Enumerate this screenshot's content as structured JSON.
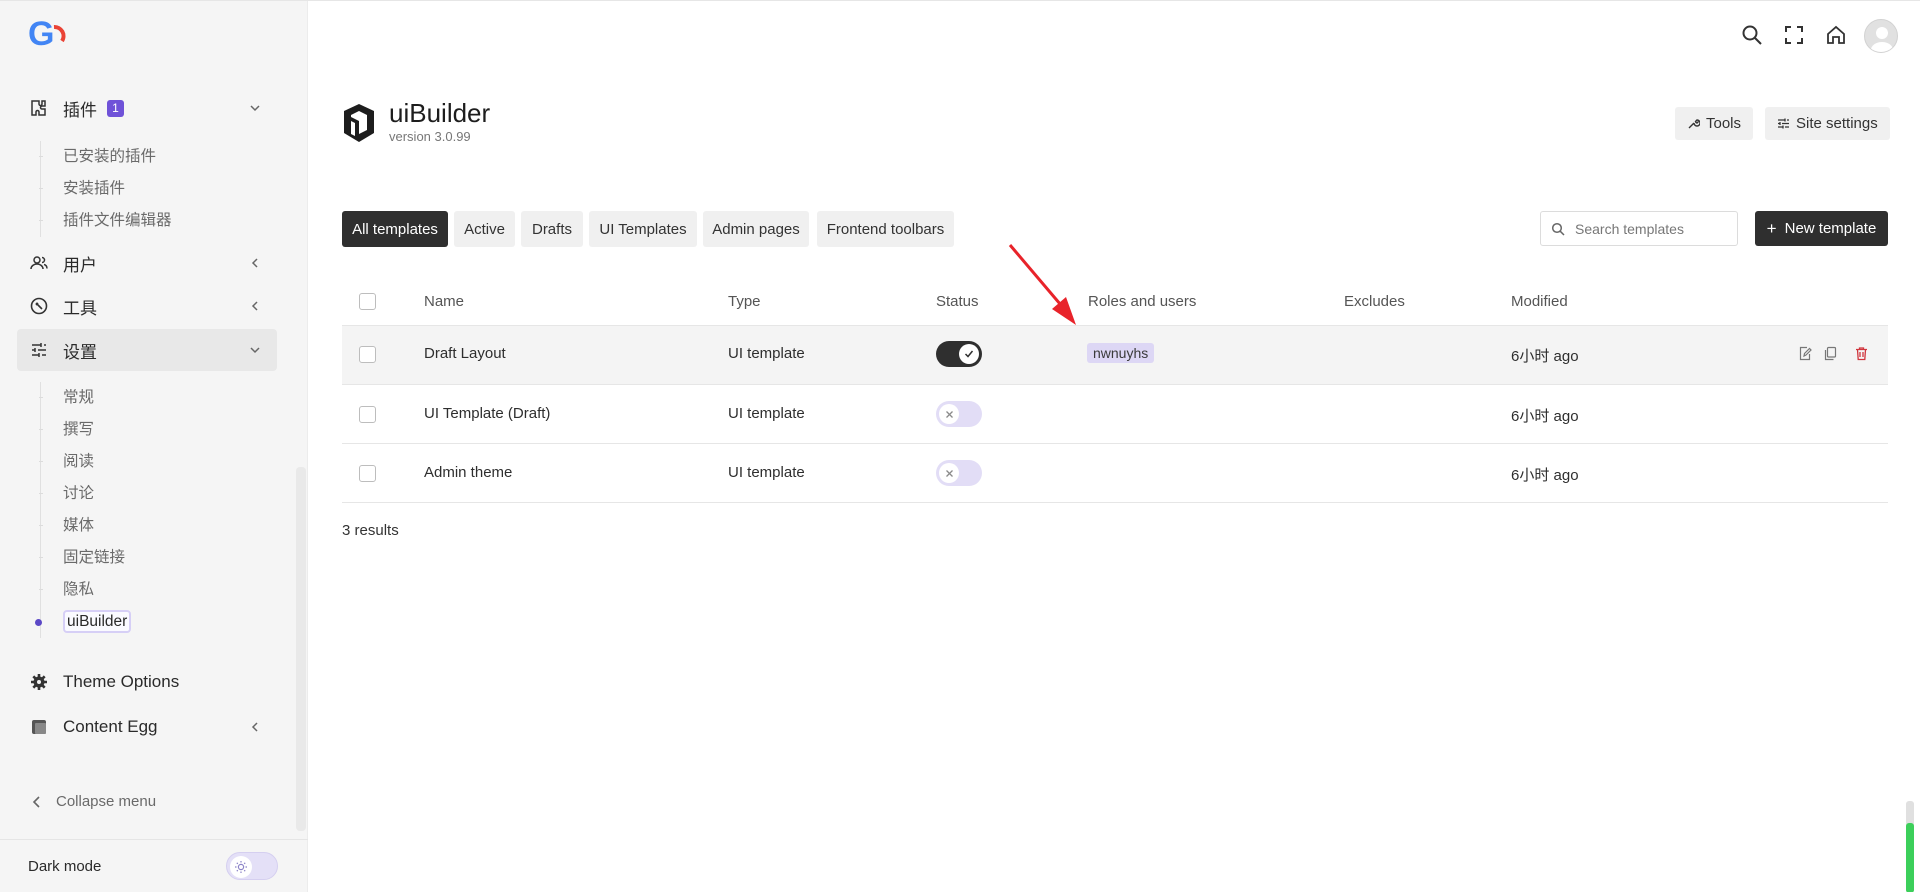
{
  "sidebar": {
    "plugins": {
      "label": "插件",
      "badge": "1",
      "items": [
        "已安装的插件",
        "安装插件",
        "插件文件编辑器"
      ]
    },
    "users": {
      "label": "用户"
    },
    "tools": {
      "label": "工具"
    },
    "settings": {
      "label": "设置",
      "items": [
        "常规",
        "撰写",
        "阅读",
        "讨论",
        "媒体",
        "固定链接",
        "隐私",
        "uiBuilder"
      ]
    },
    "theme_options": {
      "label": "Theme Options"
    },
    "content_egg": {
      "label": "Content Egg"
    },
    "collapse_label": "Collapse menu",
    "dark_mode_label": "Dark mode"
  },
  "header": {
    "title": "uiBuilder",
    "version": "version 3.0.99",
    "tools_label": "Tools",
    "site_settings_label": "Site settings"
  },
  "tabs": [
    "All templates",
    "Active",
    "Drafts",
    "UI Templates",
    "Admin pages",
    "Frontend toolbars"
  ],
  "search": {
    "placeholder": "Search templates"
  },
  "new_template_label": "New template",
  "table": {
    "columns": [
      "Name",
      "Type",
      "Status",
      "Roles and users",
      "Excludes",
      "Modified"
    ],
    "rows": [
      {
        "name": "Draft Layout",
        "type": "UI template",
        "status": "on",
        "roles": "nwnuyhs",
        "modified": "6小时 ago"
      },
      {
        "name": "UI Template (Draft)",
        "type": "UI template",
        "status": "off",
        "roles": "",
        "modified": "6小时 ago"
      },
      {
        "name": "Admin theme",
        "type": "UI template",
        "status": "off",
        "roles": "",
        "modified": "6小时 ago"
      }
    ]
  },
  "results_text": "3 results",
  "colors": {
    "accent": "#6f52d8",
    "dark": "#2f2f2f",
    "annotation": "#e8232a",
    "tag_bg": "#ddd7f5"
  }
}
